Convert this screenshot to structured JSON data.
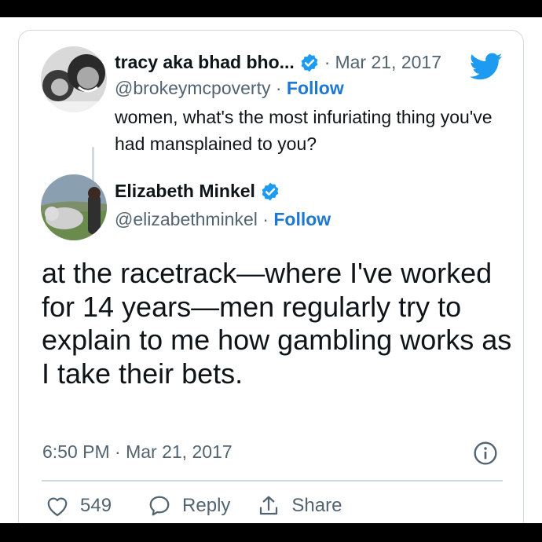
{
  "quoted_tweet": {
    "display_name": "tracy aka bhad bho...",
    "handle": "@brokeymcpoverty",
    "separator": "·",
    "date": "Mar 21, 2017",
    "follow_label": "Follow",
    "text": "women, what's the most infuriating thing you've had mansplained to you?"
  },
  "main_tweet": {
    "display_name": "Elizabeth Minkel",
    "handle": "@elizabethminkel",
    "separator": "·",
    "follow_label": "Follow",
    "text": "at the racetrack—where I've worked for 14 years—men regularly try to explain to me how gambling works as I take their bets.",
    "timestamp": "6:50 PM · Mar 21, 2017"
  },
  "actions": {
    "like_count": "549",
    "reply_label": "Reply",
    "share_label": "Share"
  },
  "icons": {
    "verified": "verified-badge-icon",
    "brand": "twitter-bird-icon",
    "info": "info-icon",
    "like": "heart-icon",
    "reply": "speech-bubble-icon",
    "share": "share-upload-icon"
  },
  "colors": {
    "brand_blue": "#1d9bf0",
    "follow_blue": "#1d78d4",
    "secondary_text": "#536471",
    "border": "#cfd9de"
  }
}
